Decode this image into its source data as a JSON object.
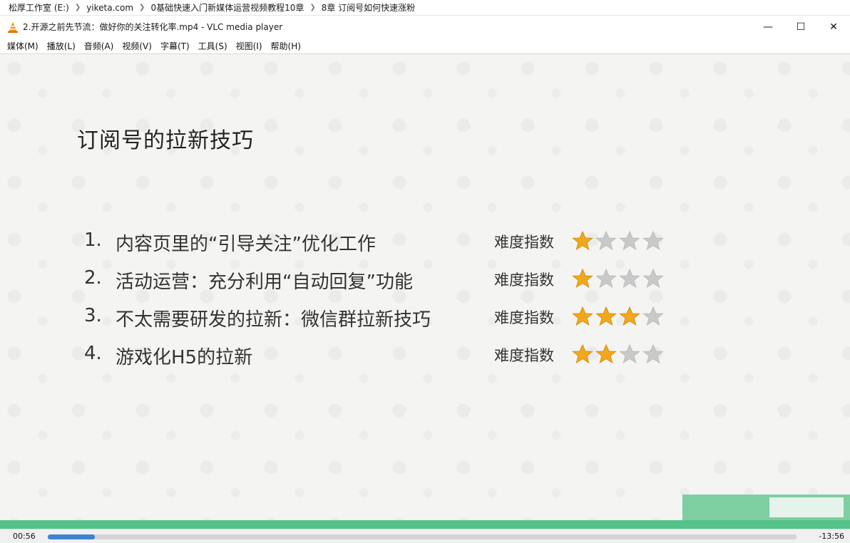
{
  "explorer": {
    "crumbs": [
      "松厚工作室 (E:)",
      "yiketa.com",
      "0基础快速入门新媒体运营视频教程10章",
      "8章 订阅号如何快速涨粉"
    ]
  },
  "window": {
    "title": "2.开源之前先节流：做好你的关注转化率.mp4 - VLC media player",
    "minimize": "—",
    "maximize": "☐",
    "close": "✕"
  },
  "menu": [
    "媒体(M)",
    "播放(L)",
    "音频(A)",
    "视频(V)",
    "字幕(T)",
    "工具(S)",
    "视图(I)",
    "帮助(H)"
  ],
  "slide": {
    "title": "订阅号的拉新技巧",
    "difficulty_label": "难度指数",
    "items": [
      {
        "num": "1.",
        "text": "内容页里的“引导关注”优化工作",
        "stars": 1
      },
      {
        "num": "2.",
        "text": "活动运营：充分利用“自动回复”功能",
        "stars": 1
      },
      {
        "num": "3.",
        "text": "不太需要研发的拉新：微信群拉新技巧",
        "stars": 3
      },
      {
        "num": "4.",
        "text": "游戏化H5的拉新",
        "stars": 2
      }
    ],
    "max_stars": 4
  },
  "player": {
    "elapsed": "00:56",
    "remaining": "-13:56",
    "progress": 0.063
  },
  "colors": {
    "star_on": "#f2a81d",
    "star_off": "#c9c9c9",
    "accent_green": "#55c28a",
    "seek_fill": "#3e83cf",
    "vlc_orange": "#ff8800"
  }
}
